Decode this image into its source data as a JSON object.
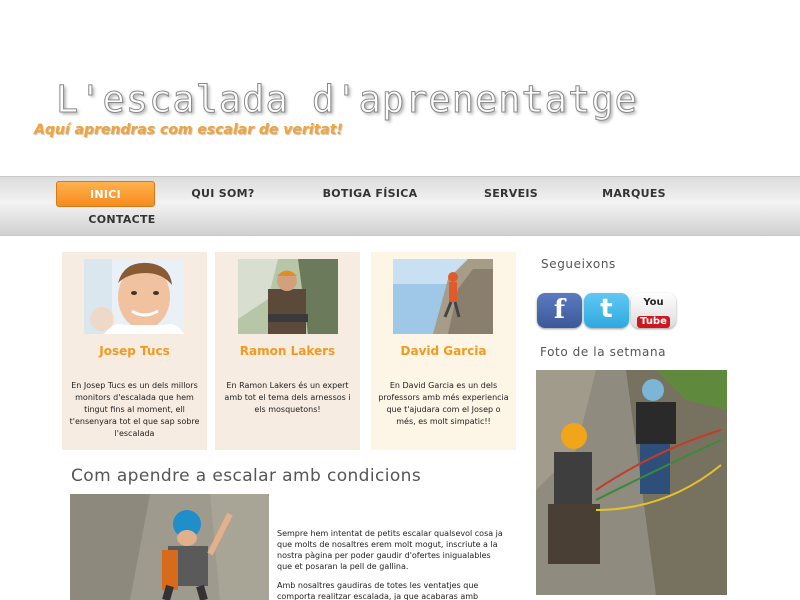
{
  "header": {
    "title": "L'escalada d'aprenentatge",
    "tagline": "Aquí aprendras com escalar de veritat!"
  },
  "nav": {
    "items": [
      {
        "label": "INICI"
      },
      {
        "label": "QUI SOM?"
      },
      {
        "label": "BOTIGA FÍSICA"
      },
      {
        "label": "SERVEIS"
      },
      {
        "label": "MARQUES"
      },
      {
        "label": "CONTACTE"
      }
    ]
  },
  "team": [
    {
      "name": "Josep Tucs",
      "bio": "En Josep Tucs es un dels millors monitors d'escalada que hem tingut fins al moment, ell t'ensenyara tot el que sap sobre l'escalada"
    },
    {
      "name": "Ramon Lakers",
      "bio": "En Ramon Lakers és un expert amb tot el tema dels arnessos i els mosquetons!"
    },
    {
      "name": "David Garcia",
      "bio": "En David Garcia es un dels professors amb més experiencia que t'ajudara com el Josep o més, es molt simpatic!!"
    }
  ],
  "sidebar": {
    "follow_heading": "Segueixons",
    "social": {
      "facebook": "f",
      "twitter": "t",
      "youtube_top": "You",
      "youtube_bottom": "Tube"
    },
    "photo_heading": "Foto de la setmana"
  },
  "main": {
    "heading": "Com apendre a escalar amb condicions",
    "paragraph1": "Sempre hem intentat de petits escalar qualsevol cosa ja que molts de nosaltres erem molt mogut, inscriute a la nostra pàgina per poder gaudir d'ofertes inigualables que et posaran la pell de gallina.",
    "paragraph2": "Amb nosaltres gaudiras de totes les ventatjes que comporta realitzar escalada, ja que acabaras amb"
  },
  "colors": {
    "accent": "#f68b1f",
    "card_bg": "#f6ece1",
    "card_bg_alt": "#fdf5e6",
    "facebook": "#3b5998",
    "twitter": "#2fa9e0",
    "youtube": "#cc181e"
  }
}
